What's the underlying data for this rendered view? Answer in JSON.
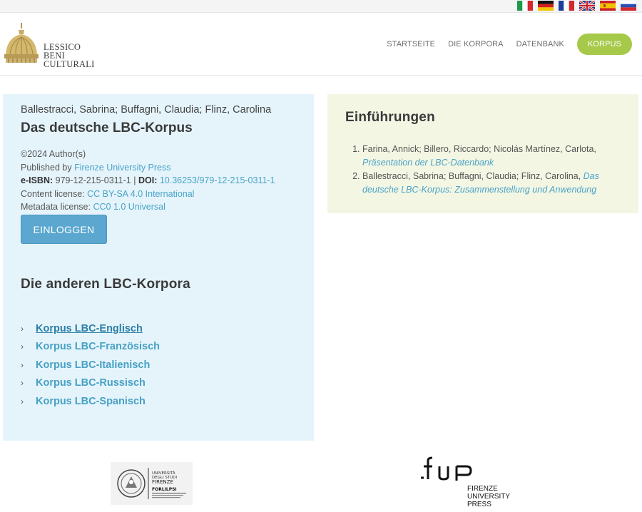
{
  "languages": [
    {
      "code": "it",
      "icon": "italian-flag-icon"
    },
    {
      "code": "de",
      "icon": "german-flag-icon"
    },
    {
      "code": "fr",
      "icon": "french-flag-icon"
    },
    {
      "code": "en",
      "icon": "uk-flag-icon"
    },
    {
      "code": "es",
      "icon": "spanish-flag-icon"
    },
    {
      "code": "ru",
      "icon": "russian-flag-icon"
    }
  ],
  "logo": {
    "line1": "LESSICO",
    "line2": "BENI CULTURALI"
  },
  "nav": {
    "items": [
      "STARTSEITE",
      "DIE KORPORA",
      "DATENBANK"
    ],
    "cta": "KORPUS"
  },
  "book": {
    "authors": "Ballestracci, Sabrina; Buffagni, Claudia; Flinz, Carolina",
    "title": "Das deutsche LBC-Korpus",
    "copyright": "©2024 Author(s)",
    "published_by_label": "Published by",
    "publisher": "Firenze University Press",
    "eisbn_label": "e-ISBN:",
    "eisbn": "979-12-215-0311-1",
    "separator": "|",
    "doi_label": "DOI:",
    "doi": "10.36253/979-12-215-0311-1",
    "content_license_label": "Content license:",
    "content_license": "CC BY-SA 4.0 International",
    "metadata_license_label": "Metadata license:",
    "metadata_license": "CC0 1.0 Universal",
    "login_label": "EINLOGGEN"
  },
  "other_corpora": {
    "heading": "Die anderen LBC-Korpora",
    "items": [
      "Korpus LBC-Englisch",
      "Korpus LBC-Französisch",
      "Korpus LBC-Italienisch",
      "Korpus LBC-Russisch",
      "Korpus LBC-Spanisch"
    ]
  },
  "introductions": {
    "heading": "Einführungen",
    "items": [
      {
        "authors": "Farina, Annick; Billero, Riccardo; Nicolás Martínez, Carlota,",
        "link": "Präsentation der LBC-Datenbank"
      },
      {
        "authors": "Ballestracci, Sabrina; Buffagni, Claudia; Flinz, Carolina,",
        "link": "Das deutsche LBC-Korpus: Zusammenstellung und Anwendung"
      }
    ]
  },
  "footer": {
    "unifi": {
      "line1": "UNIVERSITÀ",
      "line2": "DEGLI STUDI",
      "line3": "FIRENZE",
      "line4": "FORLILPSI"
    },
    "fup": {
      "mark": "fup",
      "line1": "FIRENZE",
      "line2": "UNIVERSITY",
      "line3": "PRESS"
    }
  },
  "colors": {
    "accent_green": "#a6c94a",
    "link_blue": "#47a1c4",
    "left_panel": "#e5f4fb",
    "right_panel": "#f3f6e3"
  }
}
